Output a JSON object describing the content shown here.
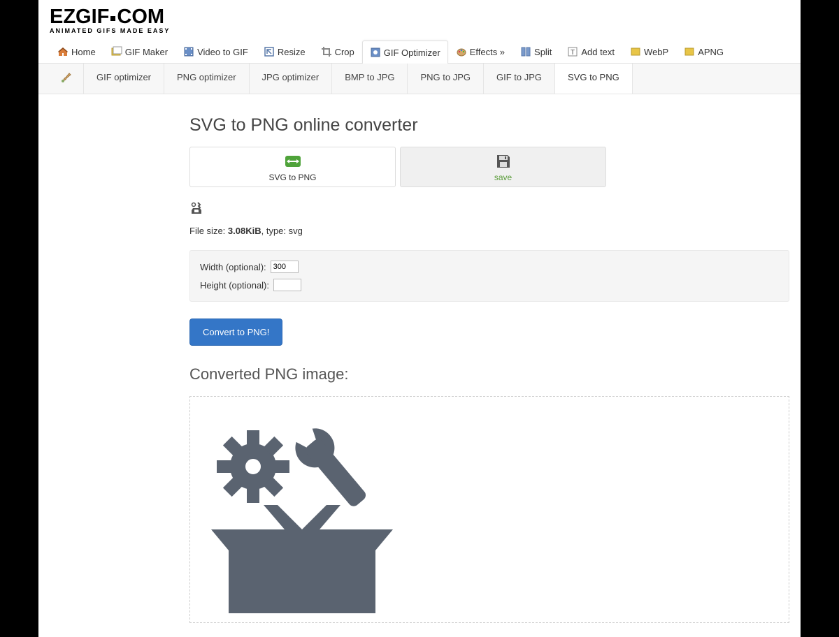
{
  "logo": {
    "main": "EZGIF",
    "ext": "COM",
    "sub": "ANIMATED GIFS MADE EASY"
  },
  "nav_main": [
    {
      "label": "Home",
      "icon": "home"
    },
    {
      "label": "GIF Maker",
      "icon": "images"
    },
    {
      "label": "Video to GIF",
      "icon": "film"
    },
    {
      "label": "Resize",
      "icon": "resize"
    },
    {
      "label": "Crop",
      "icon": "crop"
    },
    {
      "label": "GIF Optimizer",
      "icon": "optimize",
      "active": true
    },
    {
      "label": "Effects »",
      "icon": "palette"
    },
    {
      "label": "Split",
      "icon": "split"
    },
    {
      "label": "Add text",
      "icon": "text"
    },
    {
      "label": "WebP",
      "icon": "webp"
    },
    {
      "label": "APNG",
      "icon": "apng"
    }
  ],
  "nav_sub": [
    {
      "label": "GIF optimizer"
    },
    {
      "label": "PNG optimizer"
    },
    {
      "label": "JPG optimizer"
    },
    {
      "label": "BMP to JPG"
    },
    {
      "label": "PNG to JPG"
    },
    {
      "label": "GIF to JPG"
    },
    {
      "label": "SVG to PNG",
      "active": true
    }
  ],
  "page_title": "SVG to PNG online converter",
  "actions": {
    "convert": "SVG to PNG",
    "save": "save"
  },
  "file_info": {
    "size_label": "File size: ",
    "size_value": "3.08KiB",
    "type_label": ", type: ",
    "type_value": "svg"
  },
  "options": {
    "width_label": "Width (optional):",
    "width_value": "300",
    "height_label": "Height (optional):",
    "height_value": ""
  },
  "convert_button": "Convert to PNG!",
  "result_heading": "Converted PNG image:"
}
